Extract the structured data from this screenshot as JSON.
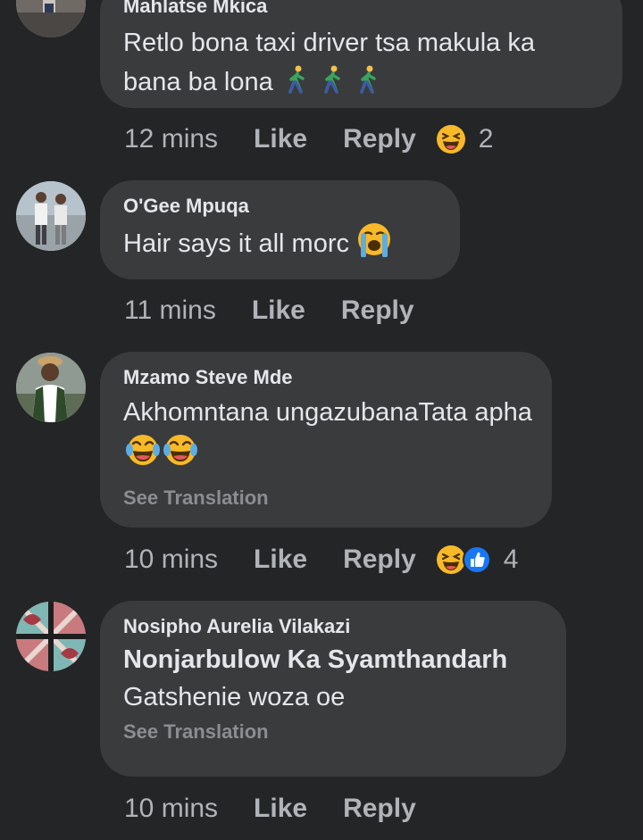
{
  "comments": [
    {
      "author": "Mahlatse Mkica",
      "text": "Retlo bona taxi driver tsa makula ka bana ba lona",
      "emoji": [
        "person-walking-icon",
        "person-walking-icon",
        "person-walking-icon"
      ],
      "time": "12 mins",
      "like_label": "Like",
      "reply_label": "Reply",
      "reactions": [
        "laughing-face-icon"
      ],
      "reaction_count": "2"
    },
    {
      "author": "O'Gee Mpuqa",
      "text": "Hair says it all morc",
      "emoji": [
        "crying-face-icon"
      ],
      "time": "11 mins",
      "like_label": "Like",
      "reply_label": "Reply"
    },
    {
      "author": "Mzamo Steve Mde",
      "text": "Akhomntana ungazubanaTata apha",
      "emoji": [
        "tears-of-joy-icon",
        "tears-of-joy-icon"
      ],
      "see_translation": "See Translation",
      "time": "10 mins",
      "like_label": "Like",
      "reply_label": "Reply",
      "reactions": [
        "laughing-face-icon",
        "like-thumb-icon"
      ],
      "reaction_count": "4"
    },
    {
      "author": "Nosipho Aurelia Vilakazi",
      "tag": "Nonjarbulow Ka Syamthandarh",
      "text": "Gatshenie woza oe",
      "see_translation": "See Translation",
      "time": "10 mins",
      "like_label": "Like",
      "reply_label": "Reply"
    }
  ],
  "colors": {
    "background": "#242526",
    "bubble": "#3a3b3c",
    "primary_text": "#e4e6eb",
    "secondary_text": "#b0b3b8",
    "translation_text": "#8a8d91",
    "like_blue": "#1877f2"
  }
}
